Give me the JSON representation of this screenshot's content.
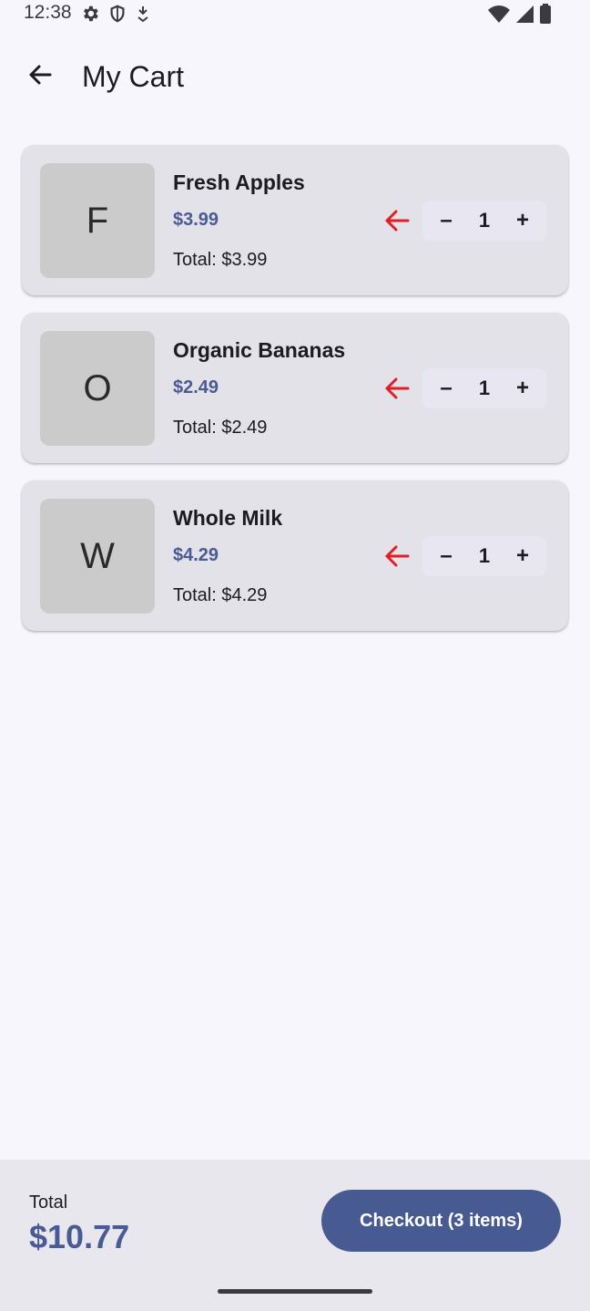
{
  "status_bar": {
    "time": "12:38",
    "icons_left": [
      "settings-icon",
      "shield-icon",
      "download-icon"
    ],
    "icons_right": [
      "wifi-icon",
      "signal-icon",
      "battery-icon"
    ]
  },
  "app_bar": {
    "title": "My Cart",
    "back_icon": "arrow-back-icon"
  },
  "colors": {
    "background": "#f7f6fd",
    "card": "#e3e2e9",
    "price_accent": "#4a5a95",
    "checkout_button": "#485a92",
    "remove_icon": "#e21d24"
  },
  "cart": {
    "items": [
      {
        "initial": "F",
        "name": "Fresh Apples",
        "price": "$3.99",
        "total": "Total: $3.99",
        "qty": "1",
        "minus": "–",
        "plus": "+"
      },
      {
        "initial": "O",
        "name": "Organic Bananas",
        "price": "$2.49",
        "total": "Total: $2.49",
        "qty": "1",
        "minus": "–",
        "plus": "+"
      },
      {
        "initial": "W",
        "name": "Whole Milk",
        "price": "$4.29",
        "total": "Total: $4.29",
        "qty": "1",
        "minus": "–",
        "plus": "+"
      }
    ]
  },
  "footer": {
    "total_label": "Total",
    "total_value": "$10.77",
    "checkout_label": "Checkout (3 items)"
  }
}
